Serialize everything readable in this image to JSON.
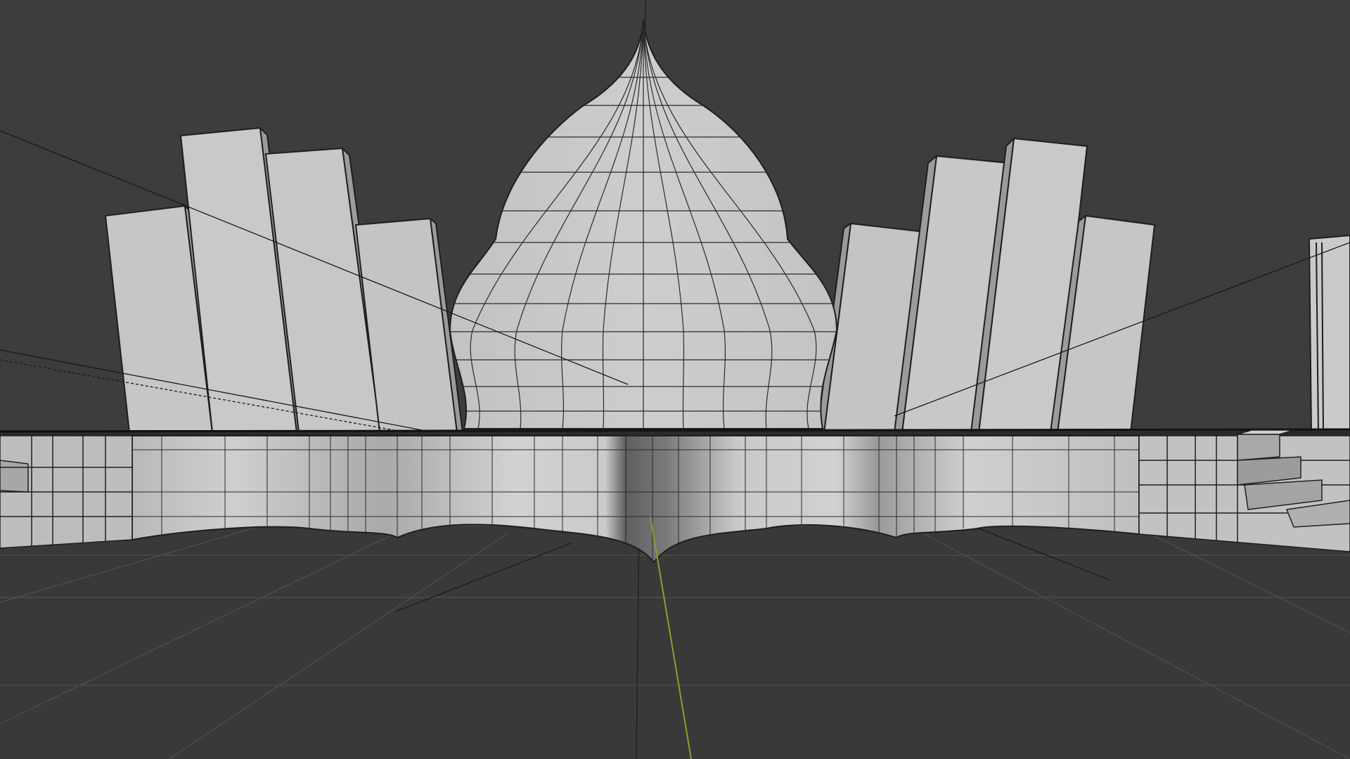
{
  "viewport": {
    "background": "#3d3d3d",
    "floor_color": "#393939",
    "grid_line_color": "#545454",
    "y_axis_color": "#7fa52a",
    "object_fill": "#c8c8c8",
    "object_fill_dark": "#8d8d8d",
    "wire_color": "#1e1e1e"
  },
  "scene": {
    "objects": [
      "onion-dome",
      "left-wall-panel-1",
      "left-wall-panel-2",
      "left-wall-panel-3",
      "left-wall-panel-4",
      "right-wall-panel-1",
      "right-wall-panel-2",
      "right-wall-panel-3",
      "right-wall-panel-4",
      "far-right-panel",
      "curved-base",
      "left-steps",
      "right-steps"
    ]
  }
}
